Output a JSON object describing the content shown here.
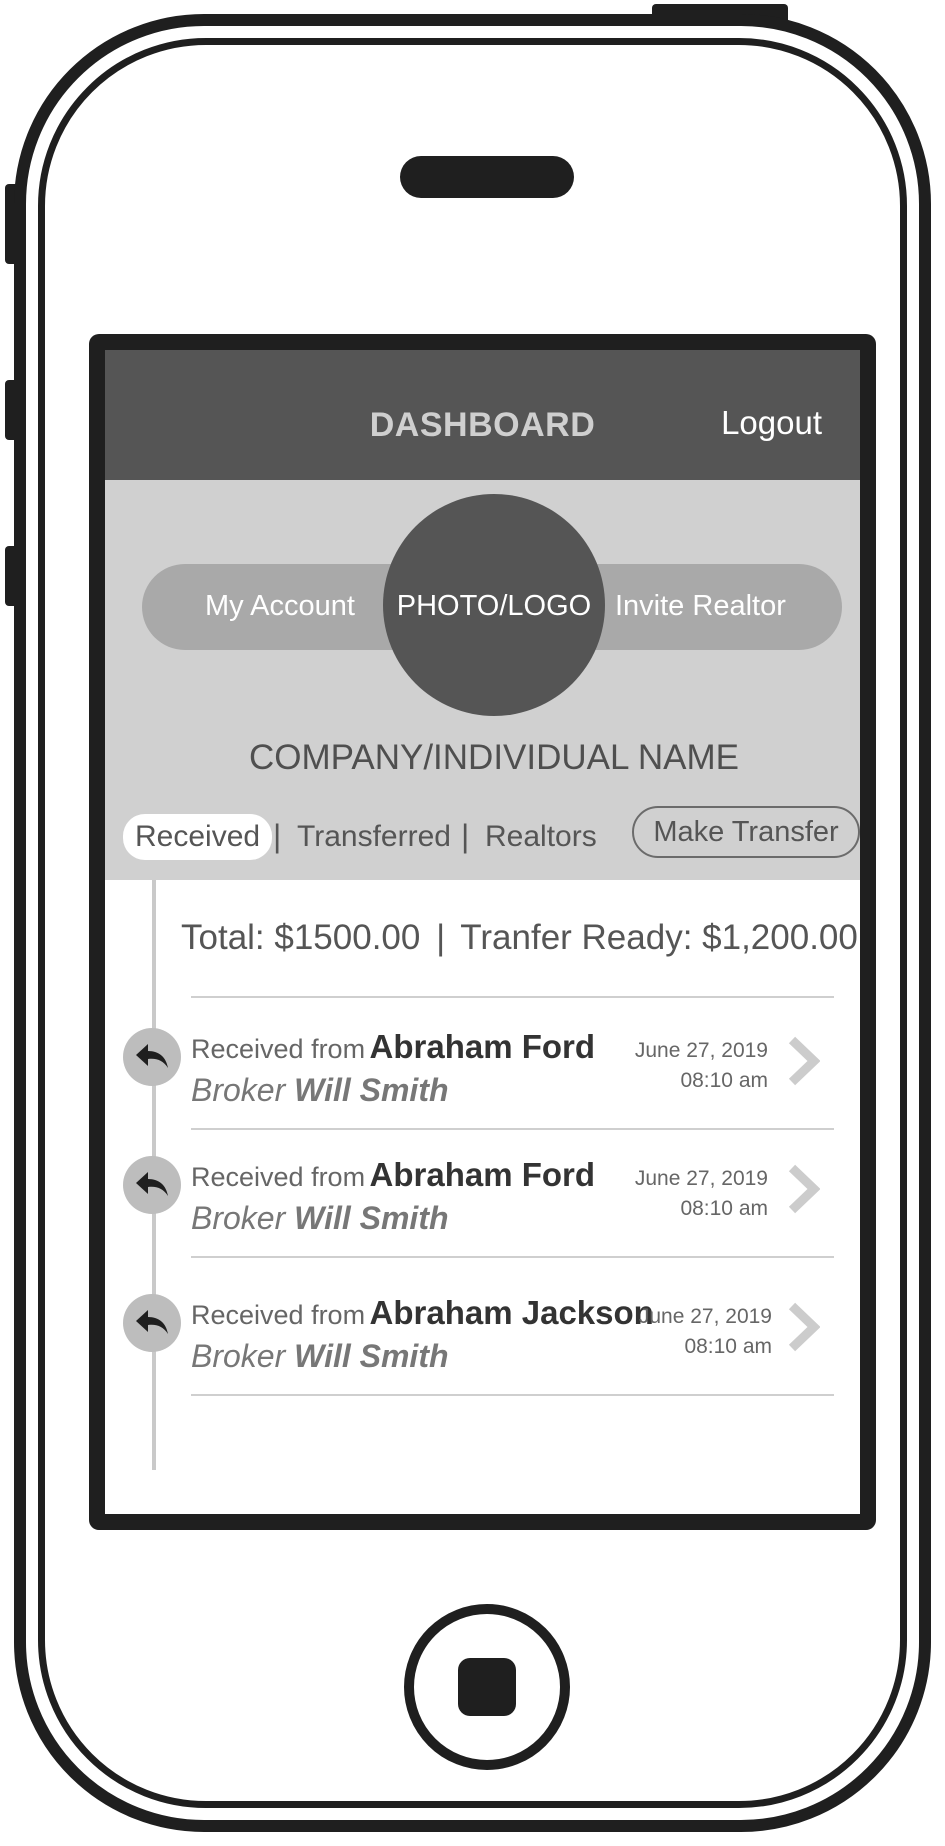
{
  "header": {
    "title": "DASHBOARD",
    "logout_label": "Logout"
  },
  "profile": {
    "my_account_label": "My Account",
    "invite_realtor_label": "Invite Realtor",
    "photo_placeholder": "PHOTO/LOGO",
    "company_name": "COMPANY/INDIVIDUAL NAME"
  },
  "tabs": {
    "received": "Received",
    "separator": "|",
    "transferred": "Transferred",
    "realtors": "Realtors",
    "make_transfer": "Make Transfer",
    "active": "Received"
  },
  "summary": {
    "total": "Total: $1500.00",
    "separator": "|",
    "transfer_ready": "Tranfer Ready: $1,200.00"
  },
  "entries": [
    {
      "prefix": "Received from",
      "name": "Abraham Ford",
      "role": "Broker",
      "broker": "Will Smith",
      "date": "June 27, 2019",
      "time": "08:10 am"
    },
    {
      "prefix": "Received from",
      "name": "Abraham Ford",
      "role": "Broker",
      "broker": "Will Smith",
      "date": "June 27, 2019",
      "time": "08:10 am"
    },
    {
      "prefix": "Received from",
      "name": "Abraham Jackson",
      "role": "Broker",
      "broker": "Will Smith",
      "date": "June 27, 2019",
      "time": "08:10 am"
    }
  ],
  "icons": {
    "entry_icon": "reply-arrow-icon",
    "entry_chevron": "chevron-right-icon"
  },
  "colors": {
    "header_bg": "#555555",
    "profile_bg": "#d0d0d0",
    "pill_bg": "#a9a9a9",
    "avatar_bg": "#555555",
    "device_frame": "#1f1f1f"
  }
}
